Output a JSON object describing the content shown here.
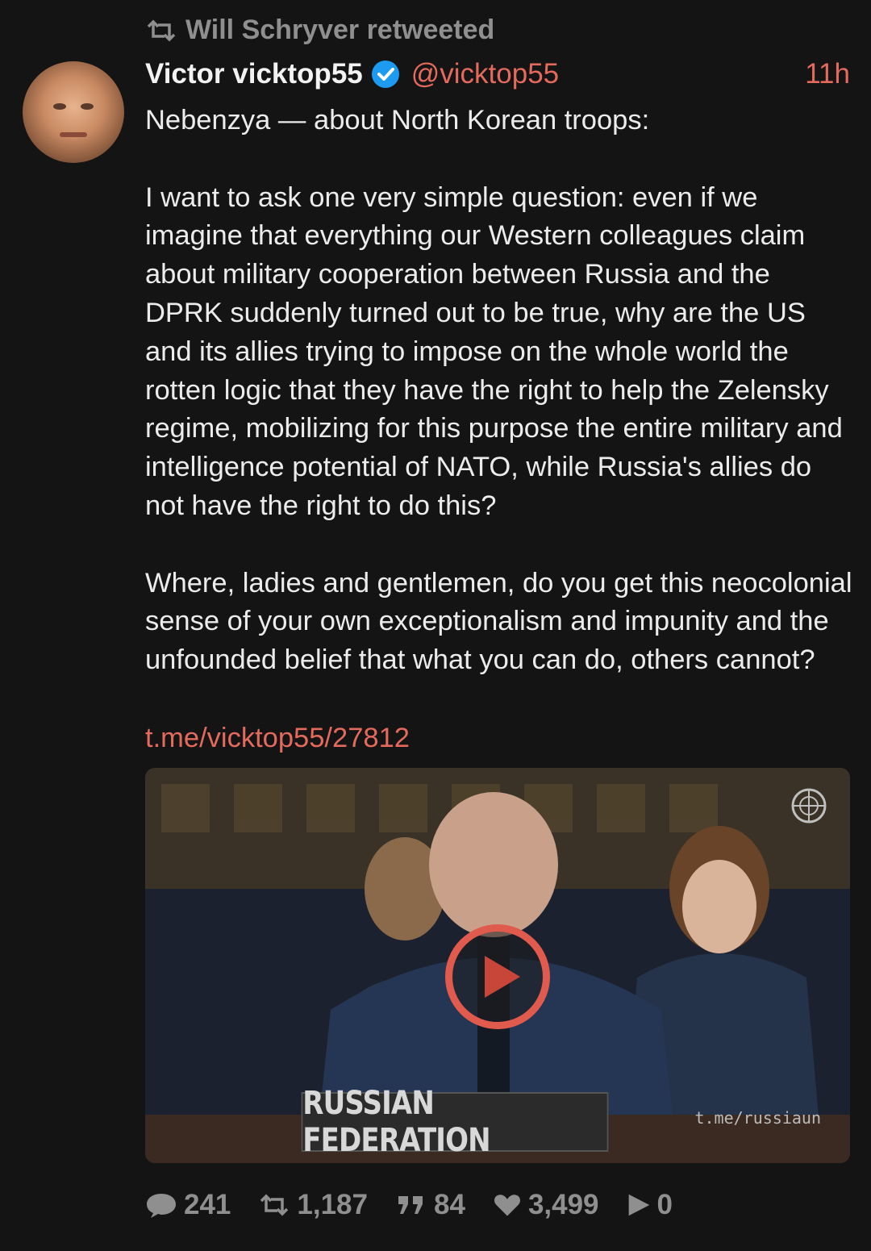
{
  "retweet": {
    "icon": "retweet-icon",
    "text": "Will Schryver retweeted"
  },
  "author": {
    "display_name": "Victor vicktop55",
    "handle": "@vicktop55",
    "verified_icon": "verified-badge-icon",
    "time": "11h"
  },
  "post": {
    "paragraphs": [
      "Nebenzya — about North Korean troops:",
      "I want to ask one very simple question: even if we imagine that everything our Western colleagues claim about military cooperation between Russia and the DPRK suddenly turned out to be true, why are the US and its allies trying to impose on the whole world the rotten logic that they have the right to help the Zelensky regime, mobilizing for this purpose the entire military and intelligence potential of NATO, while Russia's allies do not have the right to do this?",
      "Where, ladies and gentlemen, do you get this neocolonial sense of your own exceptionalism and impunity and the unfounded belief that what you can do, others cannot?"
    ],
    "link": "t.me/vicktop55/27812"
  },
  "media": {
    "nameplate": "RUSSIAN FEDERATION",
    "watermark": "t.me/russiaun",
    "play_icon": "play-icon"
  },
  "stats": {
    "replies": "241",
    "reposts": "1,187",
    "quotes": "84",
    "likes": "3,499",
    "views": "0"
  },
  "colors": {
    "background": "#141414",
    "accent": "#e36a5c",
    "muted": "#8f8f8f",
    "verified": "#1d9bf0"
  }
}
